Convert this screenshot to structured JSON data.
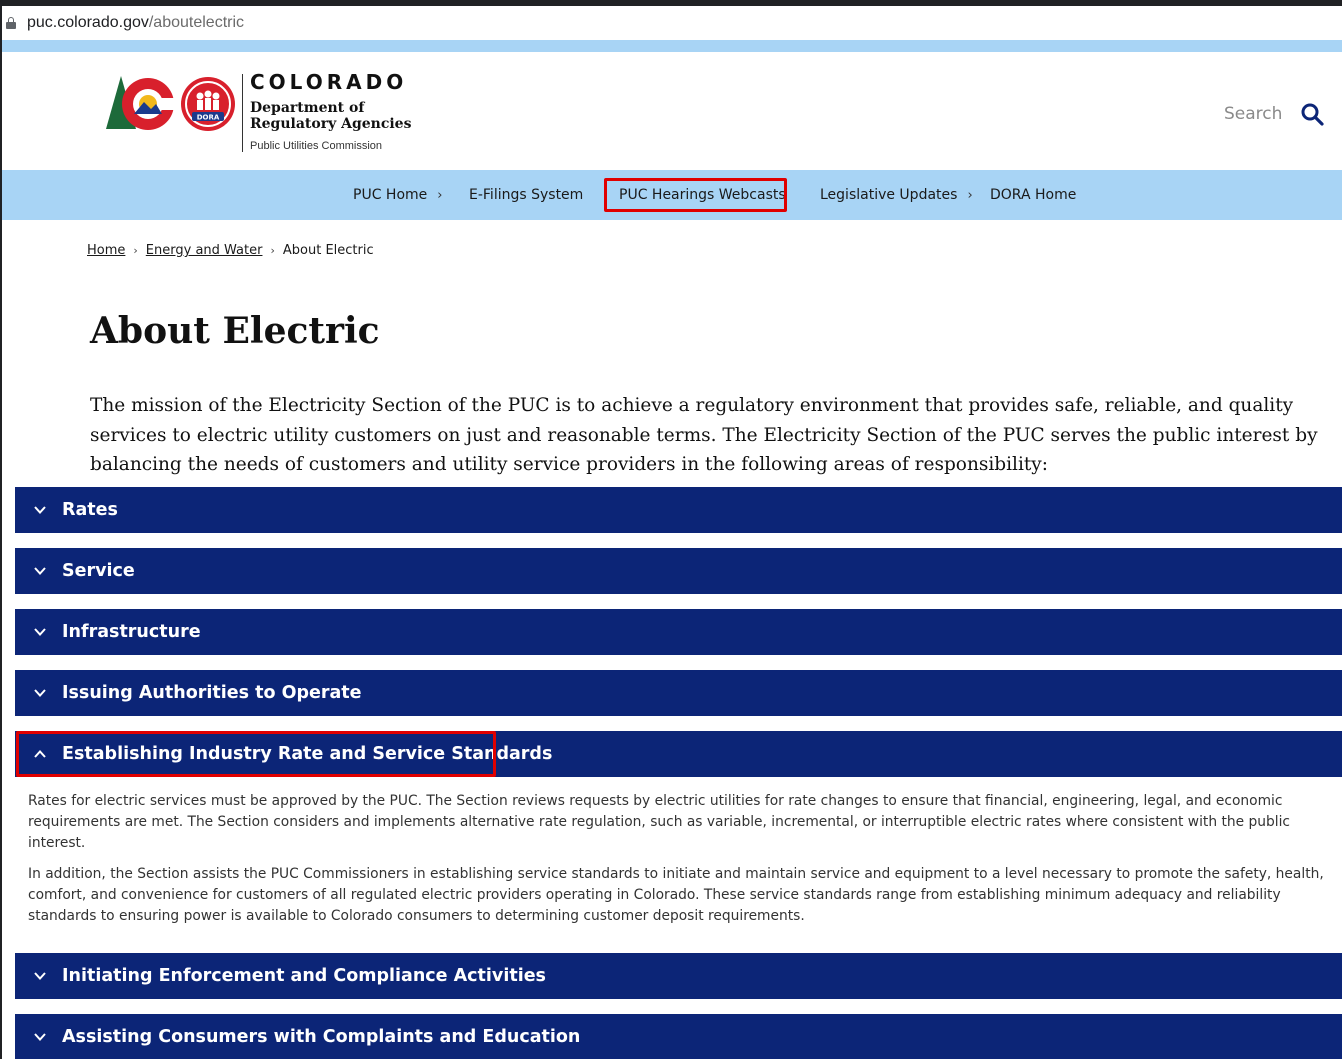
{
  "browser": {
    "url_host": "puc.colorado.gov",
    "url_path": "/aboutelectric"
  },
  "header": {
    "brand_state": "COLORADO",
    "brand_department": "Department of Regulatory Agencies",
    "brand_division": "Public Utilities Commission",
    "logo_badge_text": "DORA",
    "search_label": "Search"
  },
  "nav": {
    "items": [
      {
        "label": "PUC Home",
        "has_chevron": true
      },
      {
        "label": "E-Filings System",
        "has_chevron": false
      },
      {
        "label": "PUC Hearings Webcasts",
        "has_chevron": false,
        "highlighted": true
      },
      {
        "label": "Legislative Updates",
        "has_chevron": true
      },
      {
        "label": "DORA Home",
        "has_chevron": false
      }
    ]
  },
  "breadcrumb": {
    "items": [
      "Home",
      "Energy and Water",
      "About Electric"
    ]
  },
  "main": {
    "title": "About Electric",
    "mission": "The mission of the Electricity Section of the PUC is to achieve a regulatory environment that provides safe, reliable, and quality services to electric utility customers on just and reasonable terms. The Electricity Section of the PUC serves the public interest by balancing the needs of customers and utility service providers in the following areas of responsibility:",
    "accordions": [
      {
        "label": "Rates",
        "expanded": false
      },
      {
        "label": "Service",
        "expanded": false
      },
      {
        "label": "Infrastructure",
        "expanded": false
      },
      {
        "label": "Issuing Authorities to Operate",
        "expanded": false
      },
      {
        "label": "Establishing Industry Rate and Service Standards",
        "expanded": true,
        "highlighted": true
      },
      {
        "label": "Initiating Enforcement and Compliance Activities",
        "expanded": false
      },
      {
        "label": "Assisting Consumers with Complaints and Education",
        "expanded": false
      }
    ],
    "expanded_panel": {
      "paragraph_1": "Rates for electric services must be approved by the PUC. The Section reviews requests by electric utilities for rate changes to ensure that financial, engineering, legal, and economic requirements are met. The Section considers and implements alternative rate regulation, such as variable, incremental, or interruptible electric rates where consistent with the public interest.",
      "paragraph_2": "In addition, the Section assists the PUC Commissioners in establishing service standards to initiate and maintain service and equipment to a level necessary to promote the safety, health, comfort, and convenience for customers of all regulated electric providers operating in Colorado. These service standards range from establishing minimum adequacy and reliability standards to ensuring power is available to Colorado consumers to determining customer deposit requirements."
    }
  },
  "colors": {
    "accordion_bg": "#0c2577",
    "nav_bg": "#a8d4f5",
    "highlight_box": "#e00000"
  },
  "icons": {
    "lock": "lock-icon",
    "search": "search-icon",
    "chevron_down": "chevron-down-icon",
    "chevron_up": "chevron-up-icon",
    "chevron_right": "chevron-right-icon"
  }
}
